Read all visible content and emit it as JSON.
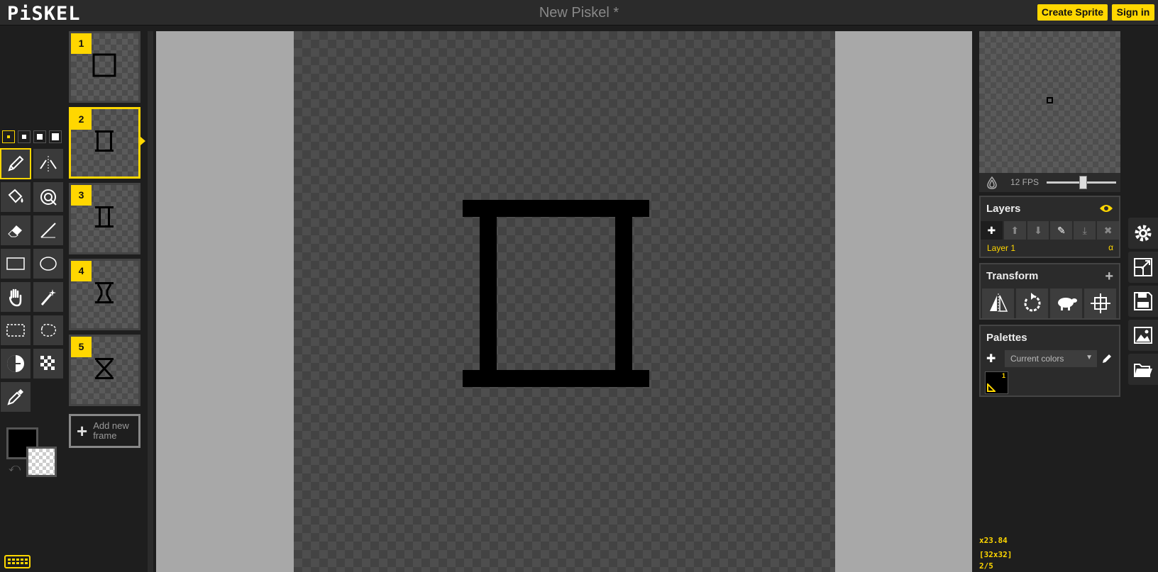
{
  "header": {
    "logo": "PiSKEL",
    "title": "New Piskel *",
    "create_label": "Create Sprite",
    "signin_label": "Sign in"
  },
  "colors": {
    "accent": "#ffd700",
    "primary_color": "#000000",
    "secondary_color": "transparent"
  },
  "pen_sizes": {
    "selected": 1,
    "count": 4
  },
  "tools": {
    "selected": "pen-tool",
    "items": [
      {
        "name": "pen-tool",
        "icon": "pencil-icon"
      },
      {
        "name": "vertical-mirror-tool",
        "icon": "mirror-pen-icon"
      },
      {
        "name": "paint-bucket-tool",
        "icon": "bucket-icon"
      },
      {
        "name": "paint-same-color-tool",
        "icon": "multi-bucket-icon"
      },
      {
        "name": "eraser-tool",
        "icon": "eraser-icon"
      },
      {
        "name": "stroke-tool",
        "icon": "line-icon"
      },
      {
        "name": "rectangle-tool",
        "icon": "rectangle-icon"
      },
      {
        "name": "circle-tool",
        "icon": "circle-icon"
      },
      {
        "name": "move-tool",
        "icon": "hand-icon"
      },
      {
        "name": "magic-wand-tool",
        "icon": "magic-wand-icon"
      },
      {
        "name": "rectangle-selection-tool",
        "icon": "rect-select-icon"
      },
      {
        "name": "lasso-selection-tool",
        "icon": "lasso-icon"
      },
      {
        "name": "lighten-tool",
        "icon": "lighten-icon"
      },
      {
        "name": "dithering-tool",
        "icon": "dither-icon"
      },
      {
        "name": "color-picker-tool",
        "icon": "eyedropper-icon"
      }
    ]
  },
  "frames": {
    "selected": 2,
    "items": [
      {
        "number": "1"
      },
      {
        "number": "2"
      },
      {
        "number": "3"
      },
      {
        "number": "4"
      },
      {
        "number": "5"
      }
    ],
    "add_label": "Add new frame"
  },
  "preview": {
    "fps_label": "12 FPS",
    "fps_value": 12
  },
  "layers": {
    "title": "Layers",
    "items": [
      {
        "name": "Layer 1",
        "opacity_label": "α"
      }
    ]
  },
  "transform": {
    "title": "Transform"
  },
  "palettes": {
    "title": "Palettes",
    "selected": "Current colors",
    "swatches": [
      {
        "index": "1",
        "color": "#000000"
      }
    ]
  },
  "status": {
    "coords": "x23.84",
    "size": "[32x32]",
    "frame": "2/5"
  }
}
